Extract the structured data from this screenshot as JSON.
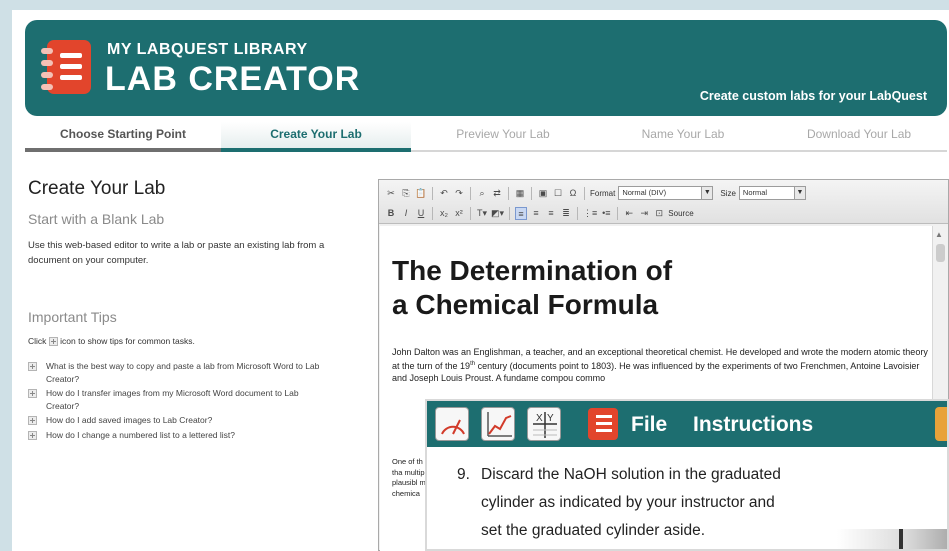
{
  "header": {
    "brand_small": "MY LABQUEST LIBRARY",
    "brand_big": "LAB CREATOR",
    "tagline": "Create custom labs for your LabQuest"
  },
  "steps": [
    {
      "label": "Choose Starting Point",
      "state": "done"
    },
    {
      "label": "Create Your Lab",
      "state": "active"
    },
    {
      "label": "Preview Your Lab",
      "state": "todo"
    },
    {
      "label": "Name Your Lab",
      "state": "todo"
    },
    {
      "label": "Download Your Lab",
      "state": "todo"
    }
  ],
  "left": {
    "title": "Create Your Lab",
    "subtitle": "Start with a Blank Lab",
    "description": "Use this web-based editor to write a lab or paste an existing lab from a document on your computer.",
    "tips_title": "Important Tips",
    "tips_hint_pre": "Click",
    "tips_hint_post": "icon to show tips for common tasks.",
    "tips": [
      "What is the best way to copy and paste a lab from Microsoft Word to Lab Creator?",
      "How do I transfer images from my Microsoft Word document to Lab Creator?",
      "How do I add saved images to Lab Creator?",
      "How do I change a numbered list to a lettered list?"
    ]
  },
  "editor": {
    "format_label": "Format",
    "format_value": "Normal (DIV)",
    "size_label": "Size",
    "size_value": "Normal",
    "source_label": "Source",
    "doc_title_line1": "The Determination of",
    "doc_title_line2": "a Chemical Formula",
    "paragraph_part1": "John Dalton was an Englishman, a teacher, and an exceptional theoretical chemist. He developed and wrote the modern atomic theory at the turn of the 19",
    "paragraph_sup": "th",
    "paragraph_part2": " century (documents point to 1803). He was influenced by the experiments of two Frenchmen, Antoine Lavoisier and Joseph Louis Proust. A fundame compou commo",
    "fragment": "One of th more tha multiple plausibl mass of chemica"
  },
  "labquest": {
    "menu_file": "File",
    "menu_instructions": "Instructions",
    "step_number": "9.",
    "line1": "Discard the NaOH solution in the graduated",
    "line2": "cylinder as indicated by your instructor and",
    "line3": "set the graduated cylinder aside."
  },
  "colors": {
    "teal": "#1d6e70",
    "accent_red": "#e2452c",
    "background": "#cfe0e6"
  }
}
